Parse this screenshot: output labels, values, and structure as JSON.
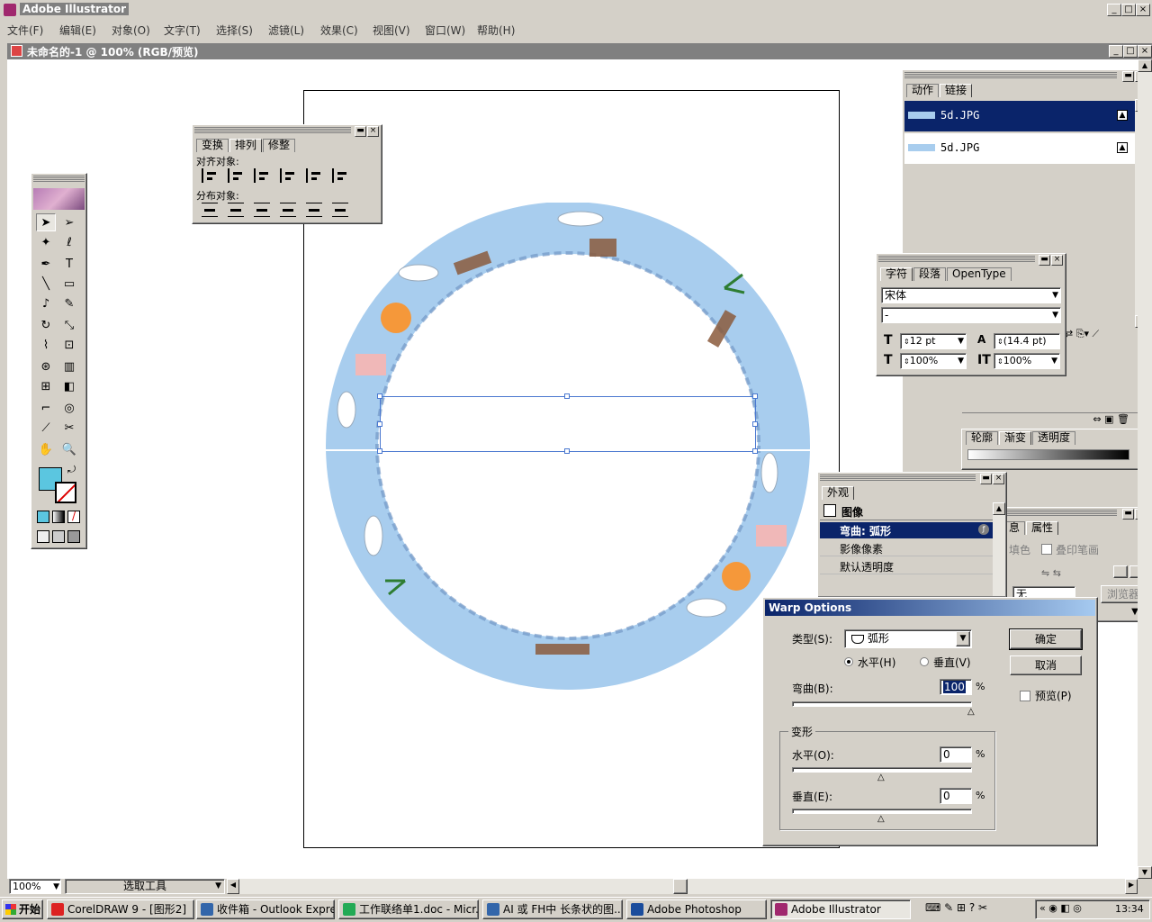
{
  "app": {
    "title": "Adobe Illustrator",
    "doc_title": "未命名的-1 @ 100% (RGB/预览)"
  },
  "menu": [
    "文件(F)",
    "编辑(E)",
    "对象(O)",
    "文字(T)",
    "选择(S)",
    "滤镜(L)",
    "效果(C)",
    "视图(V)",
    "窗口(W)",
    "帮助(H)"
  ],
  "align_panel": {
    "tabs": [
      "变换",
      "排列",
      "修整"
    ],
    "align_label": "对齐对象:",
    "distribute_label": "分布对象:"
  },
  "links_panel": {
    "tabs": [
      "动作",
      "链接"
    ],
    "items": [
      "5d.JPG",
      "5d.JPG"
    ]
  },
  "char_panel": {
    "tabs": [
      "字符",
      "段落",
      "OpenType"
    ],
    "font": "宋体",
    "style": "-",
    "size": "12 pt",
    "leading": "(14.4 pt)",
    "hscale": "100%",
    "vscale": "100%"
  },
  "gradient_panel": {
    "tabs": [
      "轮廓",
      "渐变",
      "透明度"
    ]
  },
  "appearance_panel": {
    "tab": "外观",
    "title": "图像",
    "items": [
      "弯曲: 弧形",
      "影像像素",
      "默认透明度"
    ]
  },
  "attr_panel": {
    "tabs": [
      "息",
      "属性"
    ],
    "overprint": "叠印笔画",
    "fill_label": "填色",
    "select_value": "无",
    "browser": "浏览器"
  },
  "warp_dialog": {
    "title": "Warp Options",
    "type_label": "类型(S):",
    "type_value": "弧形",
    "horizontal": "水平(H)",
    "vertical": "垂直(V)",
    "bend_label": "弯曲(B):",
    "bend_value": "100",
    "pct": "%",
    "distort_label": "变形",
    "dh_label": "水平(O):",
    "dh_value": "0",
    "dv_label": "垂直(E):",
    "dv_value": "0",
    "ok": "确定",
    "cancel": "取消",
    "preview": "预览(P)"
  },
  "status": {
    "zoom": "100%",
    "tool": "选取工具"
  },
  "taskbar": {
    "start": "开始",
    "items": [
      "CorelDRAW 9 - [图形2]",
      "收件箱 - Outlook Express",
      "工作联络单1.doc - Micr...",
      "AI 或 FH中 长条状的图...",
      "Adobe Photoshop",
      "Adobe Illustrator"
    ],
    "clock": "13:34"
  },
  "colors": {
    "ring": "#a8cdee",
    "fill_swatch": "#5bc6e0",
    "title_active": "#0a246a",
    "selection": "#4a78d0"
  }
}
